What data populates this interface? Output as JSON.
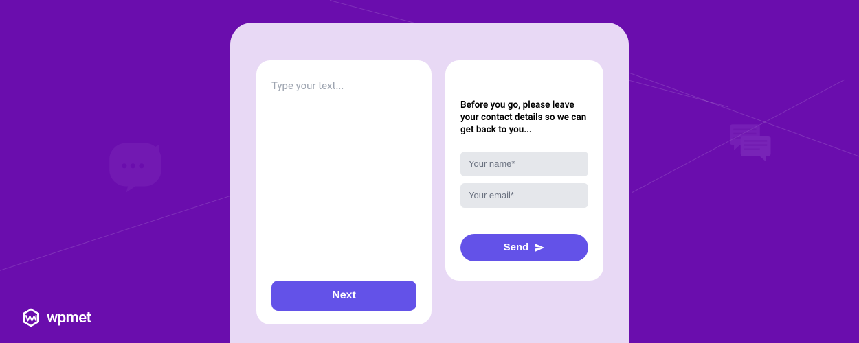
{
  "leftCard": {
    "placeholder": "Type your text...",
    "nextButton": "Next"
  },
  "rightCard": {
    "heading": "Before you go, please leave your contact details so we can get back to you...",
    "namePlaceholder": "Your name*",
    "emailPlaceholder": "Your email*",
    "sendButton": "Send"
  },
  "brand": {
    "name": "wpmet"
  }
}
